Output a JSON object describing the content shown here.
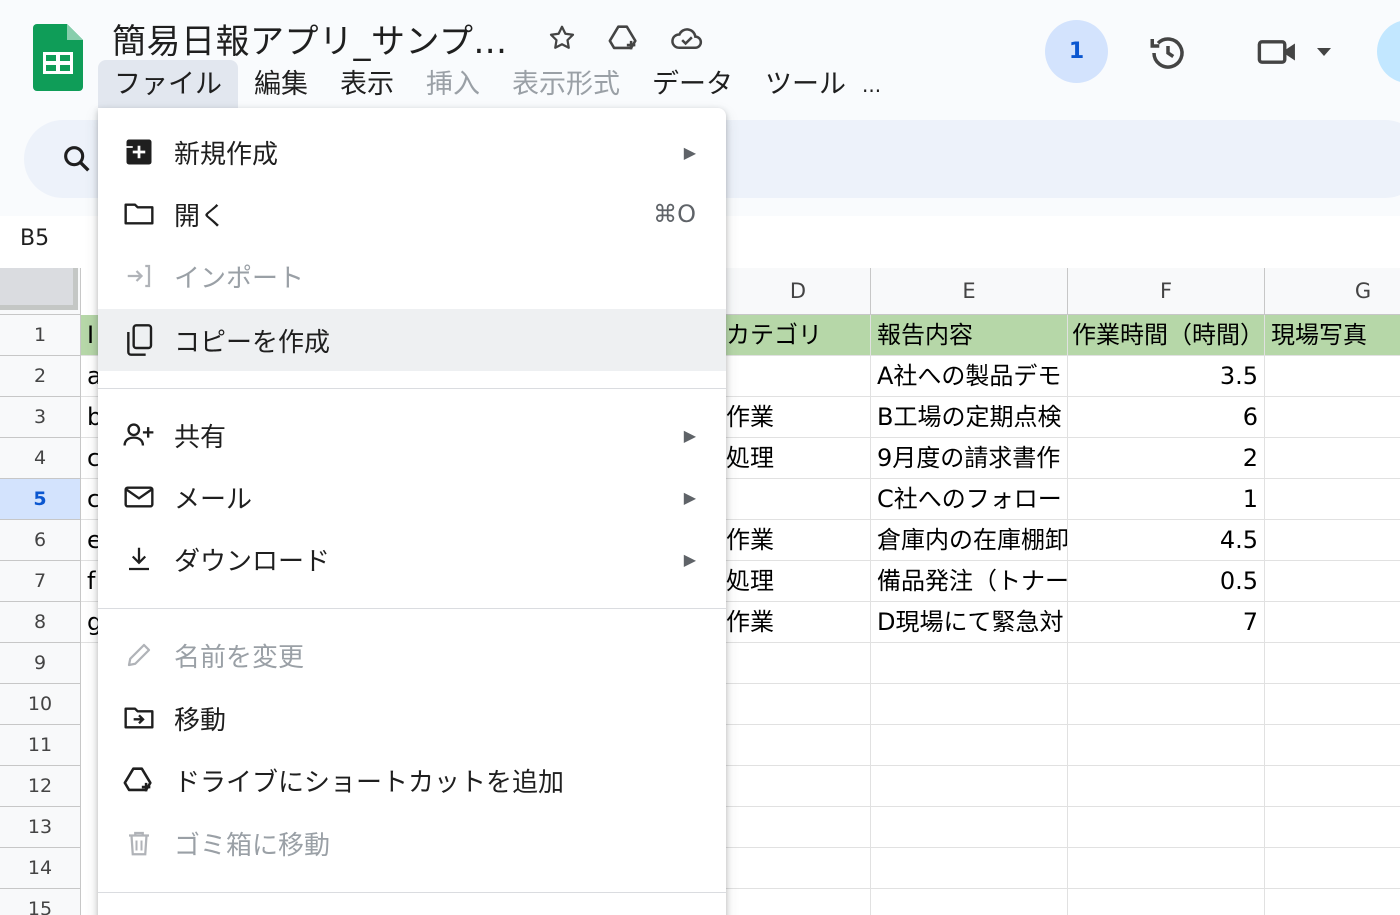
{
  "doc": {
    "title": "簡易日報アプリ_サンプ..."
  },
  "menubar": {
    "items": [
      {
        "label": "ファイル",
        "state": "active"
      },
      {
        "label": "編集",
        "state": "normal"
      },
      {
        "label": "表示",
        "state": "normal"
      },
      {
        "label": "挿入",
        "state": "disabled"
      },
      {
        "label": "表示形式",
        "state": "disabled"
      },
      {
        "label": "データ",
        "state": "normal"
      },
      {
        "label": "ツール",
        "state": "normal"
      },
      {
        "label": "...",
        "state": "normal"
      }
    ]
  },
  "header": {
    "collaborators_count": "1"
  },
  "formula_bar": {
    "name_box": "B5"
  },
  "grid": {
    "columns": [
      "D",
      "E",
      "F",
      "G"
    ],
    "rows": [
      "1",
      "2",
      "3",
      "4",
      "5",
      "6",
      "7",
      "8",
      "9",
      "10",
      "11",
      "12",
      "13",
      "14",
      "15"
    ],
    "selected_row": "5",
    "col_a_partial": [
      "I",
      "a",
      "b",
      "c",
      "c",
      "e",
      "f",
      "g"
    ],
    "header_row": [
      "カテゴリ",
      "報告内容",
      "作業時間（時間）",
      "現場写真"
    ],
    "data_rows": [
      {
        "d": "",
        "e": "A社への製品デモ",
        "f": "3.5"
      },
      {
        "d": "作業",
        "e": "B工場の定期点検",
        "f": "6"
      },
      {
        "d": "処理",
        "e": "9月度の請求書作",
        "f": "2"
      },
      {
        "d": "",
        "e": "C社へのフォロー",
        "f": "1"
      },
      {
        "d": "作業",
        "e": "倉庫内の在庫棚卸",
        "f": "4.5"
      },
      {
        "d": "処理",
        "e": "備品発注（トナー",
        "f": "0.5"
      },
      {
        "d": "作業",
        "e": "D現場にて緊急対",
        "f": "7"
      }
    ]
  },
  "file_menu": {
    "items": [
      {
        "label": "新規作成",
        "icon": "new-doc-icon",
        "has_submenu": true
      },
      {
        "label": "開く",
        "icon": "folder-icon",
        "shortcut": "⌘O"
      },
      {
        "label": "インポート",
        "icon": "import-icon",
        "disabled": true
      },
      {
        "label": "コピーを作成",
        "icon": "copy-icon",
        "highlighted": true
      },
      {
        "label": "共有",
        "icon": "person-add-icon",
        "has_submenu": true
      },
      {
        "label": "メール",
        "icon": "mail-icon",
        "has_submenu": true
      },
      {
        "label": "ダウンロード",
        "icon": "download-icon",
        "has_submenu": true
      },
      {
        "label": "名前を変更",
        "icon": "pencil-icon",
        "disabled": true
      },
      {
        "label": "移動",
        "icon": "move-folder-icon"
      },
      {
        "label": "ドライブにショートカットを追加",
        "icon": "drive-add-icon"
      },
      {
        "label": "ゴミ箱に移動",
        "icon": "trash-icon",
        "disabled": true
      }
    ]
  },
  "colors": {
    "header_row_fill": "#b6d7a8",
    "accent": "#0b57d0",
    "logo_green": "#0f9d58"
  }
}
